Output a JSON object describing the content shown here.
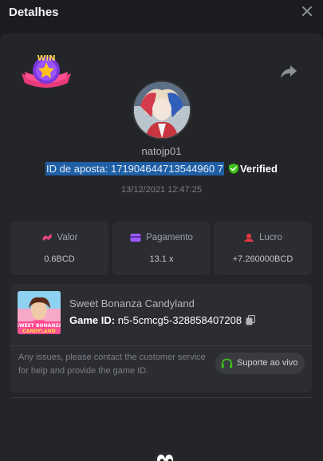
{
  "header": {
    "title": "Detalhes"
  },
  "badge": {
    "text": "WIN"
  },
  "user": {
    "name": "natojp01"
  },
  "bet": {
    "id_text": "ID de aposta: 171904644713544960 7",
    "verified_label": "Verified",
    "datetime": "13/12/2021 12:47:25"
  },
  "stats": [
    {
      "label": "Valor",
      "value": "0.6BCD"
    },
    {
      "label": "Pagamento",
      "value": "13.1 x"
    },
    {
      "label": "Lucro",
      "value": "+7.260000BCD"
    }
  ],
  "game": {
    "name": "Sweet Bonanza Candyland",
    "id_label": "Game ID:",
    "id_value": "n5-5cmcg5-328858407208",
    "thumb_text": "SWEET BONANZA CANDYLAND"
  },
  "support": {
    "message": "Any issues, please contact the customer service for help and provide the game ID.",
    "button_label": "Suporte ao vivo"
  },
  "colors": {
    "accent_green": "#3bc117",
    "highlight": "#1f5fa5",
    "valor_icon": "#e8467c",
    "pagamento_icon": "#9b59ff",
    "lucro_icon": "#e8383f"
  }
}
